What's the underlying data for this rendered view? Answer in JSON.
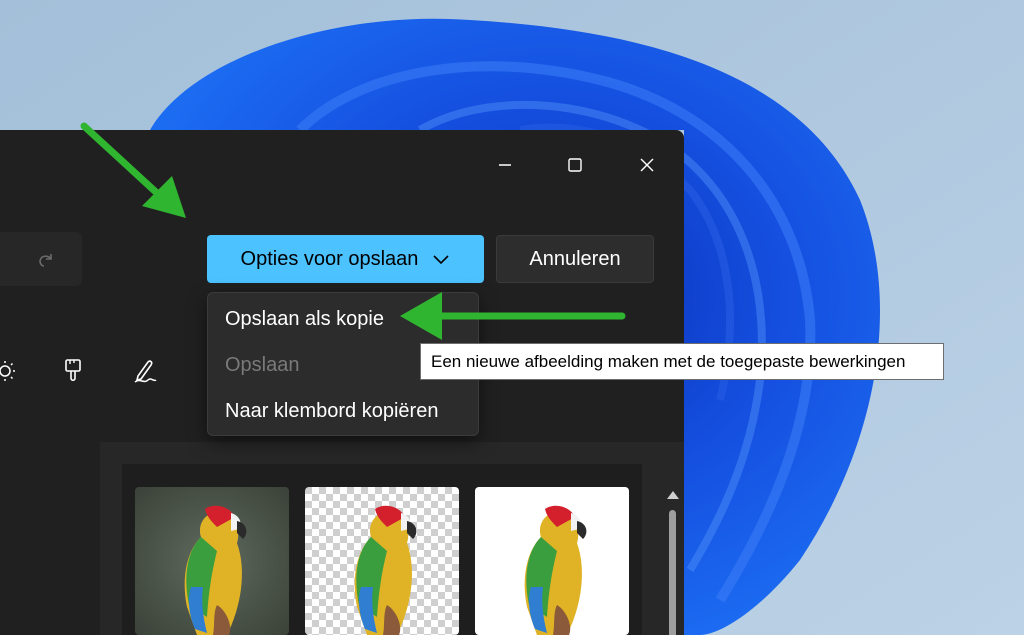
{
  "window": {
    "minimize_label": "Minimize",
    "maximize_label": "Maximize",
    "close_label": "Close"
  },
  "toolbar": {
    "save_options_label": "Opties voor opslaan",
    "cancel_label": "Annuleren"
  },
  "menu": {
    "items": [
      {
        "label": "Opslaan als kopie",
        "enabled": true
      },
      {
        "label": "Opslaan",
        "enabled": false
      },
      {
        "label": "Naar klembord kopiëren",
        "enabled": true
      }
    ]
  },
  "tooltip": {
    "text": "Een nieuwe afbeelding maken met de toegepaste bewerkingen"
  },
  "thumbnails": [
    {
      "background": "original"
    },
    {
      "background": "transparent"
    },
    {
      "background": "white"
    }
  ],
  "colors": {
    "accent": "#4cc2ff",
    "annotation_arrow": "#2fb52f",
    "window_bg": "#202020"
  },
  "icons": {
    "redo": "redo-icon",
    "brightness": "brightness-icon",
    "paint": "paint-brush-icon",
    "markup": "pen-markup-icon",
    "chevron": "chevron-down-icon"
  }
}
